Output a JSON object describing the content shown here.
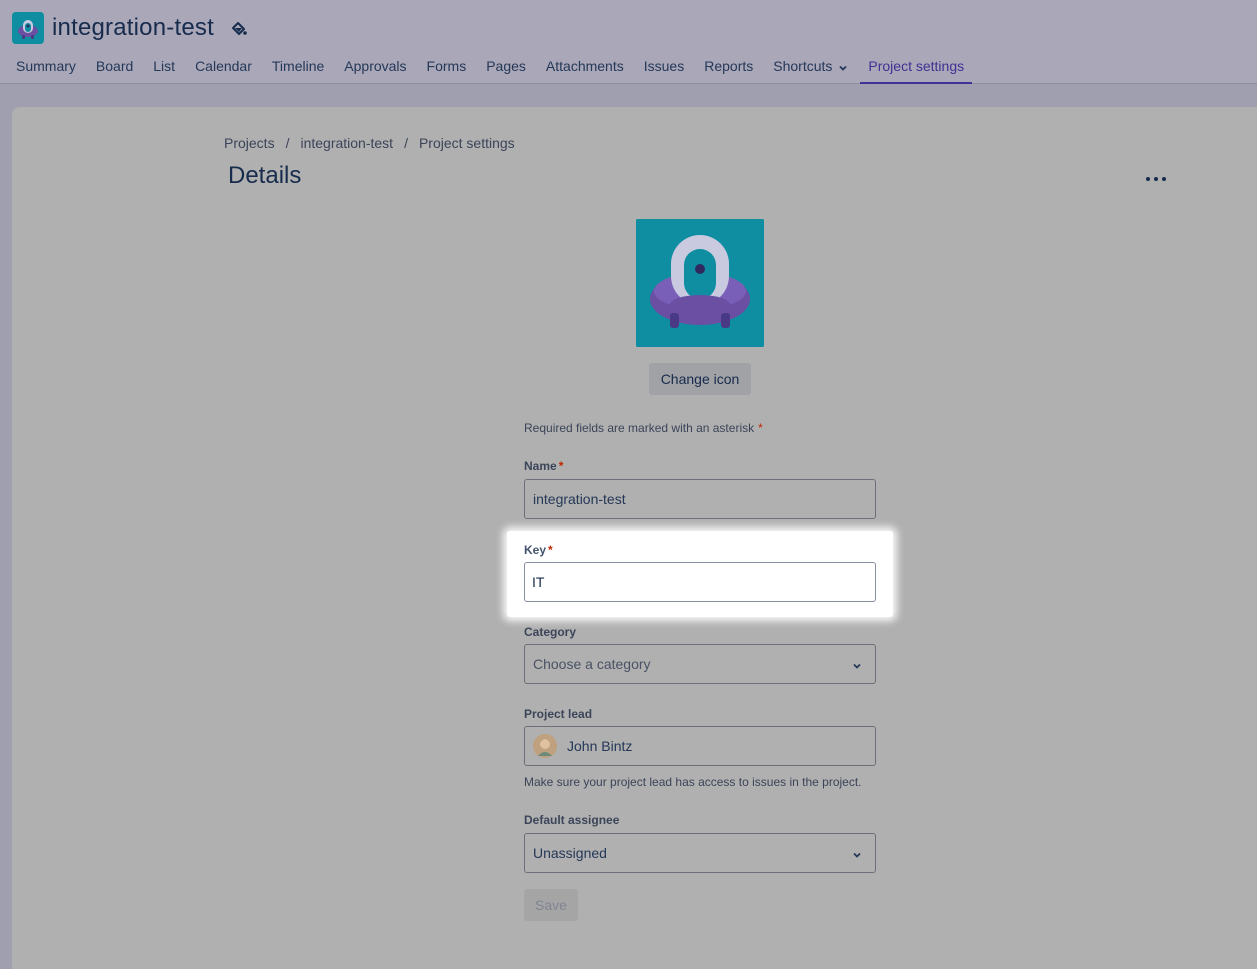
{
  "header": {
    "project_title": "integration-test",
    "avatar_icon": "ufo-robot-icon",
    "theme_icon": "paint-bucket-icon"
  },
  "nav": {
    "tabs": [
      {
        "label": "Summary"
      },
      {
        "label": "Board"
      },
      {
        "label": "List"
      },
      {
        "label": "Calendar"
      },
      {
        "label": "Timeline"
      },
      {
        "label": "Approvals"
      },
      {
        "label": "Forms"
      },
      {
        "label": "Pages"
      },
      {
        "label": "Attachments"
      },
      {
        "label": "Issues"
      },
      {
        "label": "Reports"
      },
      {
        "label": "Shortcuts"
      },
      {
        "label": "Project settings"
      }
    ],
    "active_tab": "Project settings"
  },
  "breadcrumb": {
    "items": [
      "Projects",
      "integration-test",
      "Project settings"
    ],
    "separator": "/"
  },
  "page": {
    "title": "Details",
    "change_icon_label": "Change icon",
    "required_note": "Required fields are marked with an asterisk",
    "asterisk": "*"
  },
  "form": {
    "name": {
      "label": "Name",
      "value": "integration-test"
    },
    "key": {
      "label": "Key",
      "value": "IT"
    },
    "category": {
      "label": "Category",
      "placeholder": "Choose a category"
    },
    "project_lead": {
      "label": "Project lead",
      "value": "John Bintz",
      "helper": "Make sure your project lead has access to issues in the project."
    },
    "default_assignee": {
      "label": "Default assignee",
      "value": "Unassigned"
    },
    "save_label": "Save"
  },
  "colors": {
    "accent": "#403294",
    "brand_icon_bg": "#0f8ea2",
    "required": "#bf2600"
  }
}
